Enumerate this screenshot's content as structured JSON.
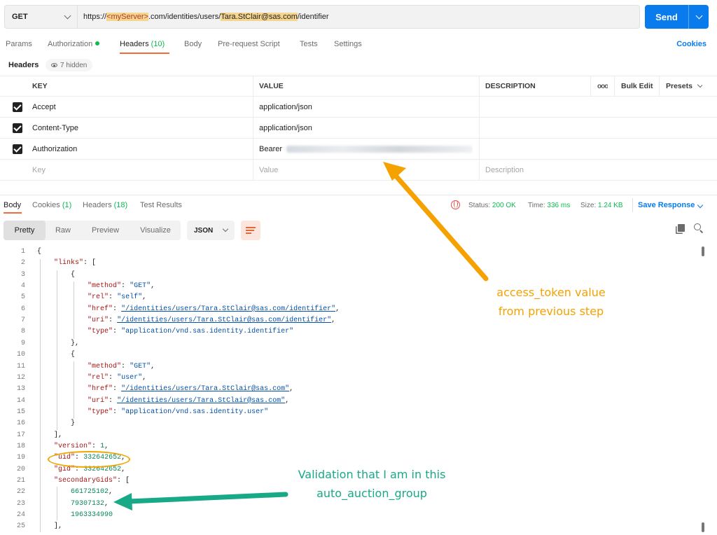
{
  "request": {
    "method": "GET",
    "url_parts": [
      "https://",
      "<myServer>",
      ".com/identities/users/",
      "Tara.StClair@sas.com",
      "/identifier"
    ],
    "send_label": "Send"
  },
  "request_tabs": {
    "params": "Params",
    "authorization": "Authorization",
    "headers_label": "Headers",
    "headers_count": "(10)",
    "body": "Body",
    "prerequest": "Pre-request Script",
    "tests": "Tests",
    "settings": "Settings",
    "cookies": "Cookies"
  },
  "headers_section": {
    "title": "Headers",
    "hidden": "7 hidden"
  },
  "headers_table": {
    "columns": [
      "KEY",
      "VALUE",
      "DESCRIPTION"
    ],
    "bulk_edit": "Bulk Edit",
    "presets": "Presets",
    "rows": [
      {
        "key": "Accept",
        "value": "application/json"
      },
      {
        "key": "Content-Type",
        "value": "application/json"
      },
      {
        "key": "Authorization",
        "value": "Bearer"
      }
    ],
    "placeholders": {
      "key": "Key",
      "value": "Value",
      "description": "Description"
    }
  },
  "response_tabs": {
    "body": "Body",
    "cookies_label": "Cookies",
    "cookies_count": "(1)",
    "headers_label": "Headers",
    "headers_count": "(18)",
    "test_results": "Test Results"
  },
  "response_status": {
    "status_label": "Status:",
    "status_value": "200 OK",
    "time_label": "Time:",
    "time_value": "336 ms",
    "size_label": "Size:",
    "size_value": "1.24 KB",
    "save_response": "Save Response"
  },
  "view_modes": [
    "Pretty",
    "Raw",
    "Preview",
    "Visualize"
  ],
  "format": "JSON",
  "code_lines": [
    {
      "n": "1",
      "t": "{"
    },
    {
      "n": "2",
      "t": "    \"links\": ["
    },
    {
      "n": "3",
      "t": "        {"
    },
    {
      "n": "4",
      "t": "            \"method\": \"GET\","
    },
    {
      "n": "5",
      "t": "            \"rel\": \"self\","
    },
    {
      "n": "6",
      "t": "            \"href\": \"/identities/users/Tara.StClair@sas.com/identifier\","
    },
    {
      "n": "7",
      "t": "            \"uri\": \"/identities/users/Tara.StClair@sas.com/identifier\","
    },
    {
      "n": "8",
      "t": "            \"type\": \"application/vnd.sas.identity.identifier\""
    },
    {
      "n": "9",
      "t": "        },"
    },
    {
      "n": "10",
      "t": "        {"
    },
    {
      "n": "11",
      "t": "            \"method\": \"GET\","
    },
    {
      "n": "12",
      "t": "            \"rel\": \"user\","
    },
    {
      "n": "13",
      "t": "            \"href\": \"/identities/users/Tara.StClair@sas.com\","
    },
    {
      "n": "14",
      "t": "            \"uri\": \"/identities/users/Tara.StClair@sas.com\","
    },
    {
      "n": "15",
      "t": "            \"type\": \"application/vnd.sas.identity.user\""
    },
    {
      "n": "16",
      "t": "        }"
    },
    {
      "n": "17",
      "t": "    ],"
    },
    {
      "n": "18",
      "t": "    \"version\": 1,"
    },
    {
      "n": "19",
      "t": "    \"uid\": 332642652,"
    },
    {
      "n": "20",
      "t": "    \"gid\": 332642652,"
    },
    {
      "n": "21",
      "t": "    \"secondaryGids\": ["
    },
    {
      "n": "22",
      "t": "        661725102,"
    },
    {
      "n": "23",
      "t": "        79307132,"
    },
    {
      "n": "24",
      "t": "        1963334990"
    },
    {
      "n": "25",
      "t": "    ],"
    }
  ],
  "annotations": {
    "token_note": [
      "access_token value",
      "from previous step"
    ],
    "group_note": [
      "Validation that I am in this",
      "auto_auction_group"
    ]
  },
  "colors": {
    "accent_blue": "#097bed",
    "tab_underline": "#f26b3a",
    "status_green": "#0cbb52",
    "annotation_orange": "#f5a100",
    "annotation_green": "#18a987"
  }
}
